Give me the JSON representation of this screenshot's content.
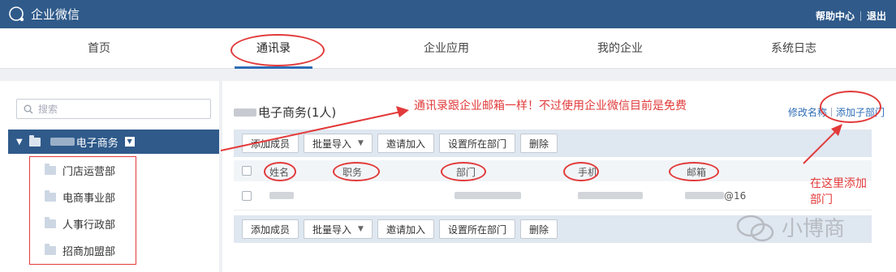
{
  "topbar": {
    "brand": "企业微信",
    "links": [
      "帮助中心",
      "退出"
    ]
  },
  "nav": {
    "tabs": [
      "首页",
      "通讯录",
      "企业应用",
      "我的企业",
      "系统日志"
    ],
    "active": "通讯录"
  },
  "sidebar": {
    "search_placeholder": "搜索",
    "root_dept": "电子商务",
    "sub_depts": [
      "门店运营部",
      "电商事业部",
      "人事行政部",
      "招商加盟部"
    ]
  },
  "main": {
    "dept_title": "电子商务(1人)",
    "right_links": [
      "修改名称",
      "添加子部门"
    ],
    "toolbar_buttons": [
      "添加成员",
      "批量导入",
      "邀请加入",
      "设置所在部门",
      "删除"
    ],
    "columns": [
      "姓名",
      "职务",
      "部门",
      "手机",
      "邮箱"
    ],
    "row_email_suffix": "@16"
  },
  "annotations": {
    "top_note": "通讯录跟企业邮箱一样！不过使用企业微信目前是免费",
    "side_note_line1": "在这里添加",
    "side_note_line2": "部门"
  },
  "watermark": "小博商",
  "colors": {
    "topbar": "#2f5a8a",
    "accent": "#2f6db6",
    "annotation_red": "#e23a3a"
  }
}
